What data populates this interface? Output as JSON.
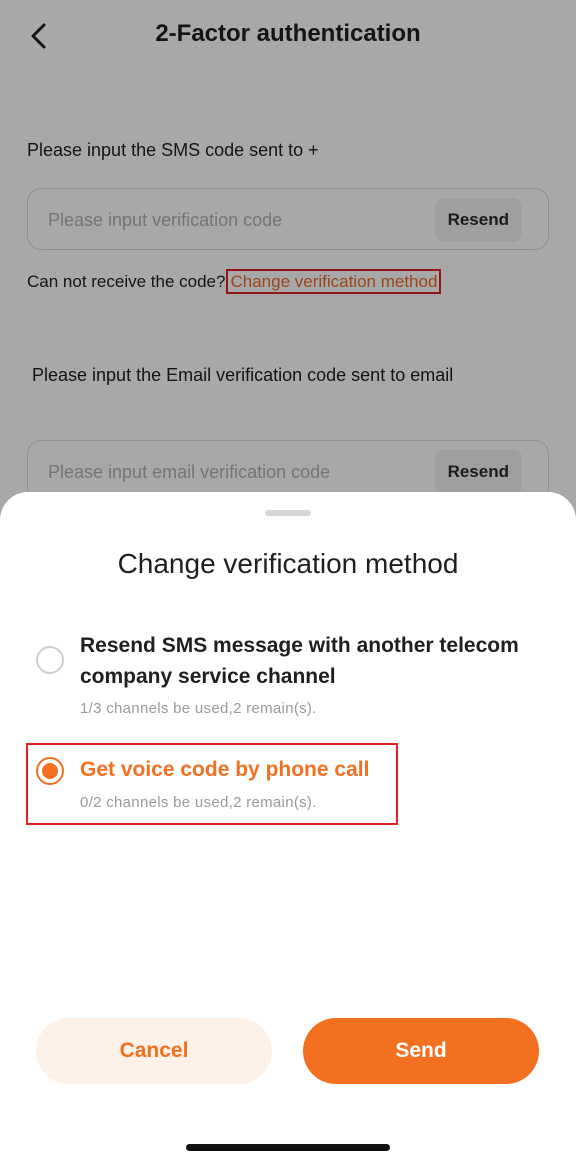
{
  "header": {
    "title": "2-Factor authentication"
  },
  "sms": {
    "label": "Please input the SMS code sent to +",
    "placeholder": "Please input verification code",
    "resend_label": "Resend",
    "cant_receive": "Can not receive the code?",
    "change_link": "Change verification method"
  },
  "email": {
    "label": "Please input the Email verification code sent to email",
    "placeholder": "Please input email verification code",
    "resend_label": "Resend"
  },
  "sheet": {
    "title": "Change verification method",
    "options": [
      {
        "title_line1": "Resend SMS message with another telecom",
        "title_line2": "company service channel",
        "subtitle": "1/3 channels be used,2 remain(s).",
        "selected": false
      },
      {
        "title_line1": "Get voice code by phone call",
        "subtitle": "0/2 channels be used,2 remain(s).",
        "selected": true
      }
    ],
    "cancel_label": "Cancel",
    "send_label": "Send"
  },
  "colors": {
    "accent": "#f37021",
    "highlight": "#e02020"
  },
  "icons": {
    "back": "chevron-left-icon"
  }
}
